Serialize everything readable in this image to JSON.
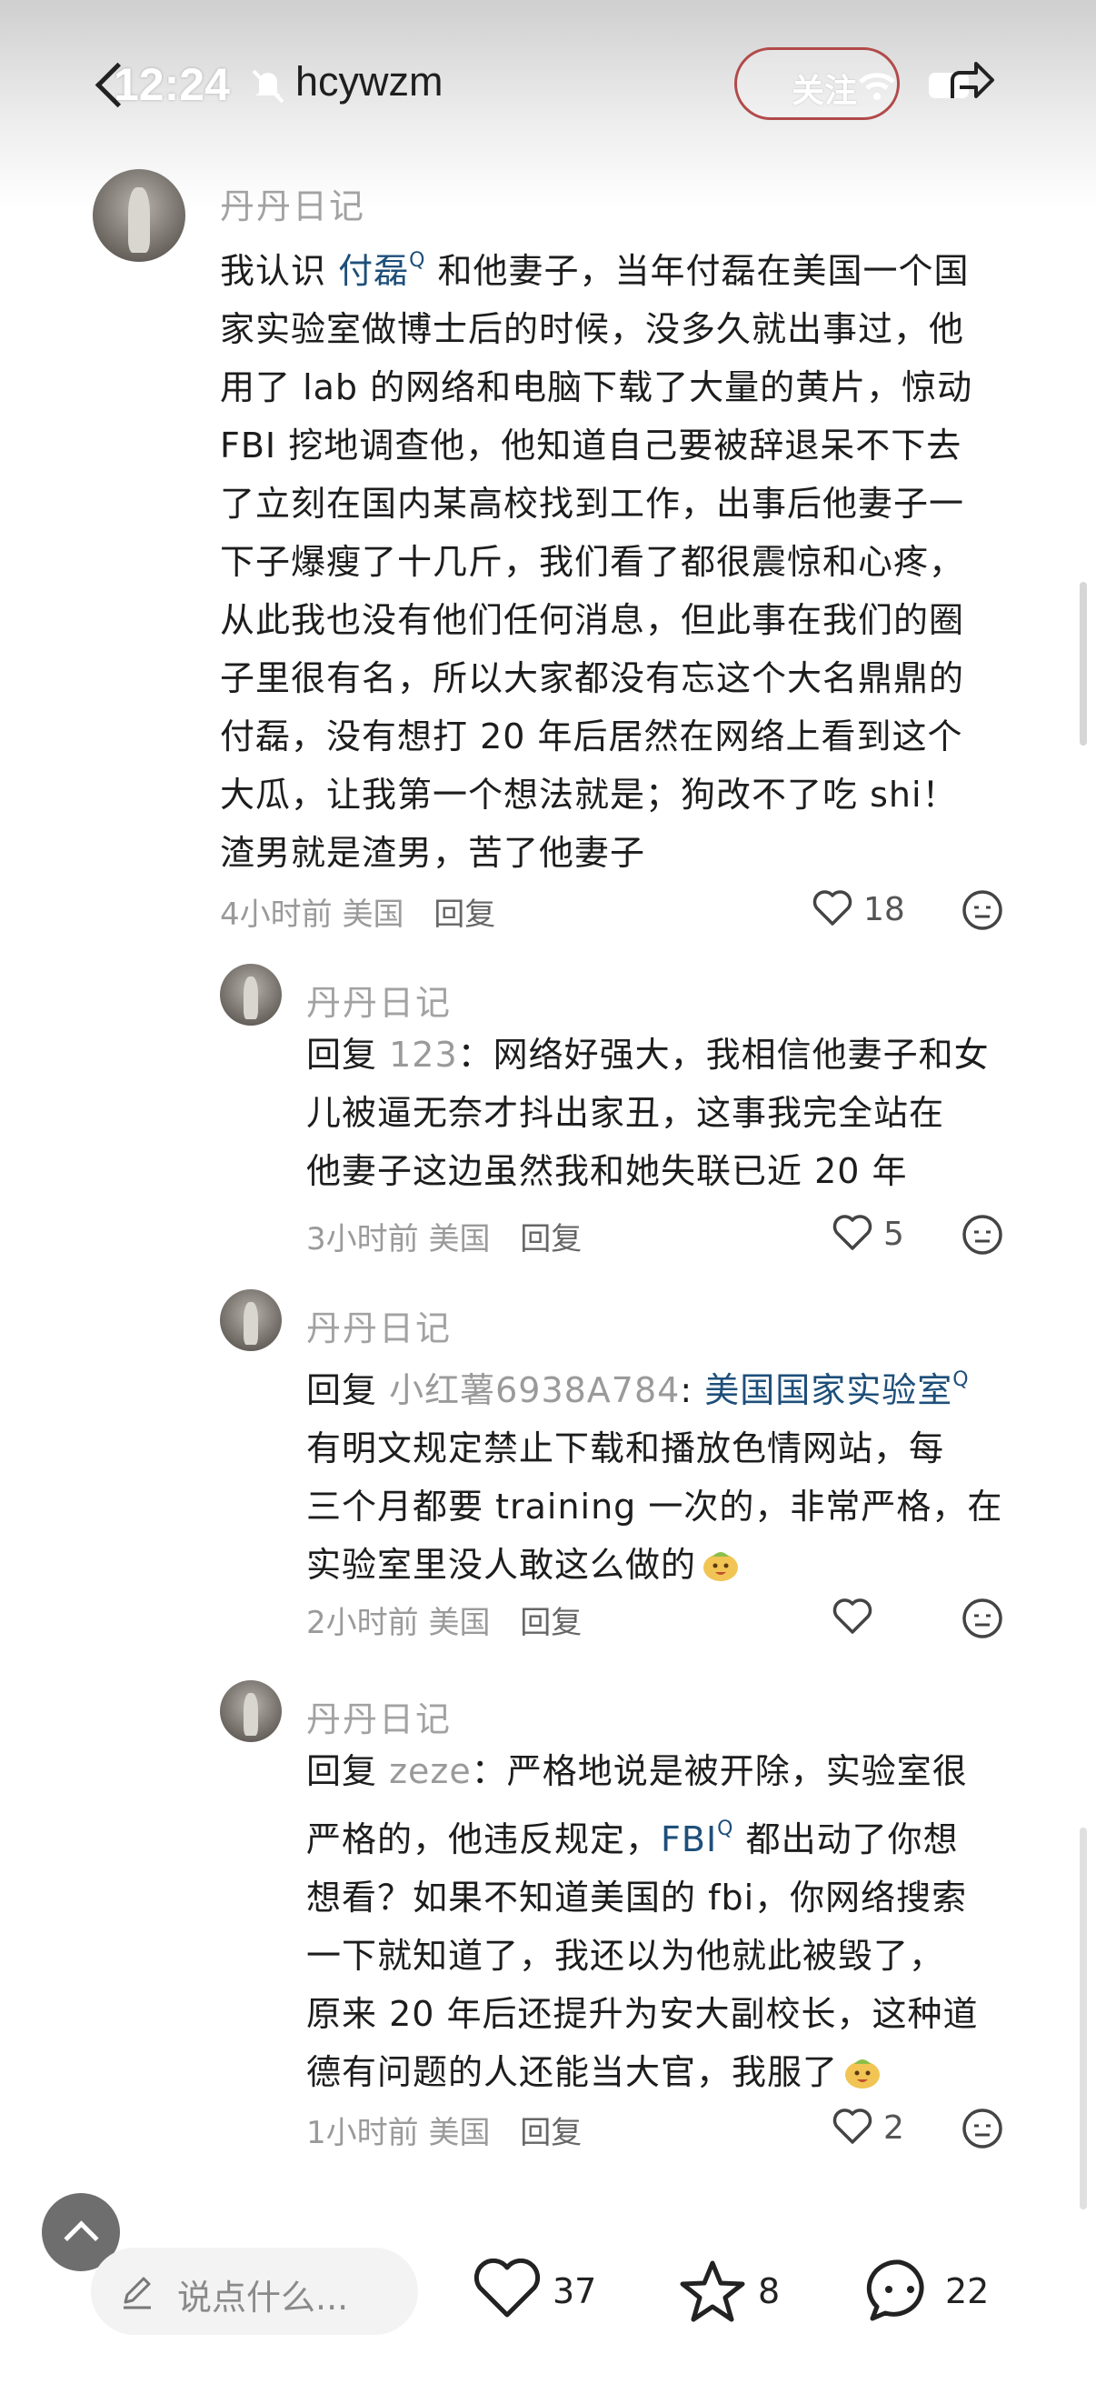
{
  "status": {
    "time": "12:24"
  },
  "header": {
    "author": "hcywzm",
    "follow_label": "关注"
  },
  "comments": [
    {
      "user": "丹丹日记",
      "lines": [
        [
          "我认识 ",
          "付磊",
          " 和他妻子，当年付磊在美国一个国"
        ],
        "家实验室做博士后的时候，没多久就出事过，他",
        "用了 lab 的网络和电脑下载了大量的黄片，惊动",
        "FBI 挖地调查他，他知道自己要被辞退呆不下去",
        "了立刻在国内某高校找到工作，出事后他妻子一",
        "下子爆瘦了十几斤，我们看了都很震惊和心疼，",
        "从此我也没有他们任何消息，但此事在我们的圈",
        "子里很有名，所以大家都没有忘这个大名鼎鼎的",
        "付磊，没有想打 20 年后居然在网络上看到这个",
        "大瓜，让我第一个想法就是；狗改不了吃 shi！",
        "渣男就是渣男，苦了他妻子"
      ],
      "time": "4小时前",
      "location": "美国",
      "reply": "回复",
      "likes": "18"
    },
    {
      "user": "丹丹日记",
      "prefix": "回复 ",
      "reply_to": "123",
      "lines": [
        "：网络好强大，我相信他妻子和女",
        "儿被逼无奈才抖出家丑，这事我完全站在",
        "他妻子这边虽然我和她失联已近 20 年"
      ],
      "time": "3小时前",
      "location": "美国",
      "reply": "回复",
      "likes": "5"
    },
    {
      "user": "丹丹日记",
      "prefix": "回复 ",
      "reply_to": "小红薯6938A784",
      "mention": "美国国家实验室",
      "lines": [
        "有明文规定禁止下载和播放色情网站，每",
        "三个月都要 training 一次的，非常严格，在",
        "实验室里没人敢这么做的"
      ],
      "time": "2小时前",
      "location": "美国",
      "reply": "回复",
      "likes": ""
    },
    {
      "user": "丹丹日记",
      "prefix": "回复 ",
      "reply_to": "zeze",
      "lines": [
        "：严格地说是被开除，实验室很",
        [
          "严格的，他违反规定，",
          "FBI",
          " 都出动了你想"
        ],
        "想看？如果不知道美国的 fbi，你网络搜索",
        "一下就知道了，我还以为他就此被毁了，",
        "原来 20 年后还提升为安大副校长，这种道",
        "德有问题的人还能当大官，我服了"
      ],
      "time": "1小时前",
      "location": "美国",
      "reply": "回复",
      "likes": "2"
    }
  ],
  "bottom_bar": {
    "input_placeholder": "说点什么...",
    "likes": "37",
    "favorites": "8",
    "comments": "22"
  },
  "colors": {
    "follow_border": "#b24a4a",
    "mention": "#1e4f7a",
    "meta": "#9a9a9a"
  }
}
